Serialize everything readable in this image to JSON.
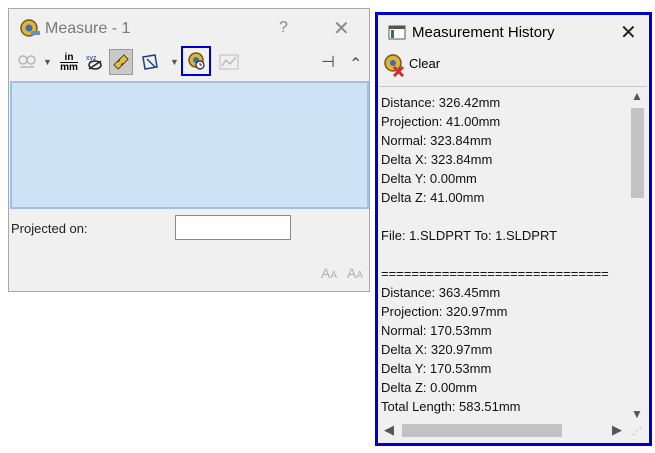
{
  "measure": {
    "title": "Measure - 1",
    "help": "?",
    "close": "✕",
    "toolbar": {
      "unit_top": "in",
      "unit_bottom": "mm",
      "xyz": "xyz",
      "pin": "⊣",
      "collapse": "⌃"
    },
    "projected_on_label": "Projected on:",
    "projected_on_value": "",
    "font_small": "A",
    "font_large": "A"
  },
  "history": {
    "title": "Measurement History",
    "close": "✕",
    "clear_label": "Clear",
    "lines": [
      "Distance: 326.42mm",
      "Projection: 41.00mm",
      "Normal: 323.84mm",
      "Delta X: 323.84mm",
      "Delta Y: 0.00mm",
      "Delta Z: 41.00mm",
      "",
      "File: 1.SLDPRT To: 1.SLDPRT",
      "",
      "==============================",
      "Distance: 363.45mm",
      "Projection: 320.97mm",
      "Normal: 170.53mm",
      "Delta X: 320.97mm",
      "Delta Y: 170.53mm",
      "Delta Z: 0.00mm",
      "Total Length: 583.51mm"
    ]
  },
  "colors": {
    "highlight_border": "#0000cc",
    "results_box": "#cfe3f6",
    "panel_bg": "#f0f0f0"
  }
}
